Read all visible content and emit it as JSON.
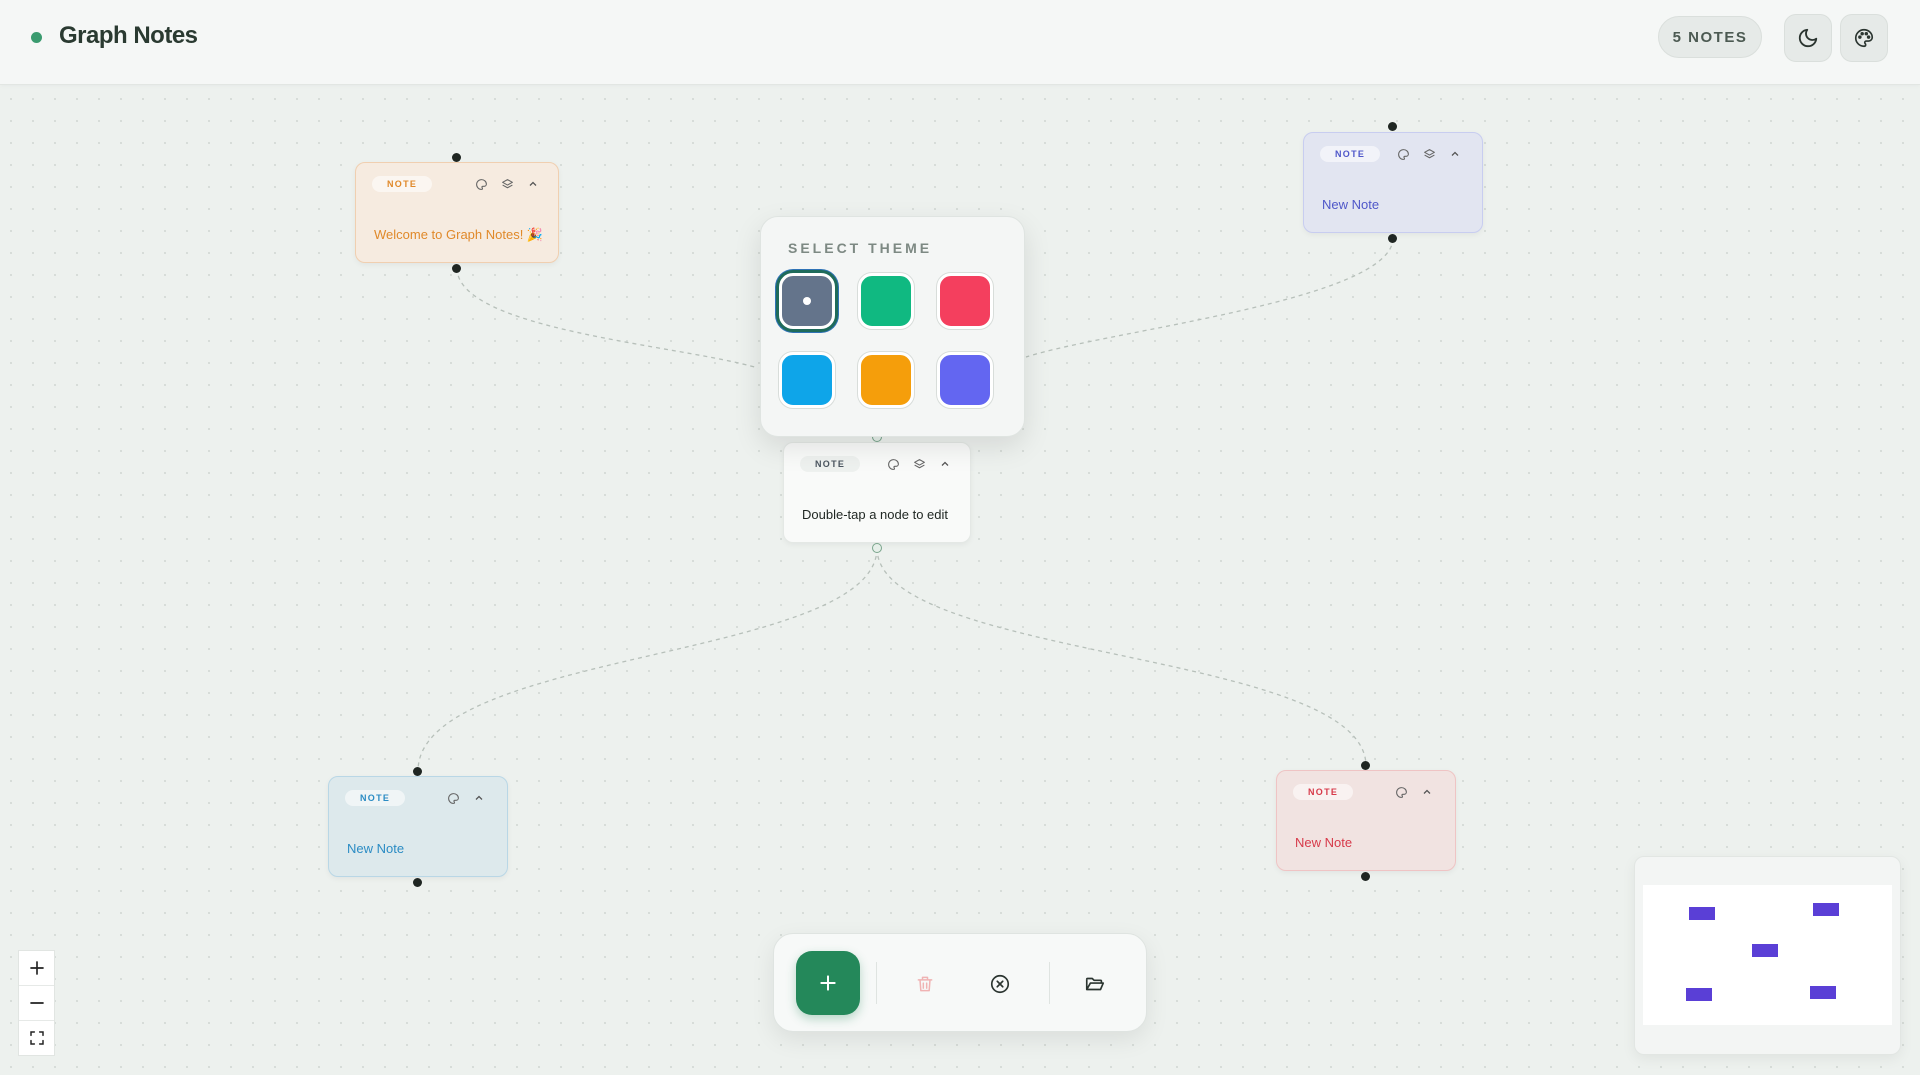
{
  "header": {
    "title": "Graph Notes",
    "notes_count": "5 NOTES",
    "dark_mode_icon": "moon-icon",
    "theme_icon": "palette-icon",
    "status_color": "#3a9b6f"
  },
  "notes": [
    {
      "id": "welcome",
      "badge": "NOTE",
      "text": "Welcome to Graph Notes! 🎉",
      "theme": "orange",
      "accent": "#e0892a",
      "bg": "#f6ebe0",
      "border": "#f0cfb0",
      "icons": [
        "palette-icon",
        "layers-icon",
        "chevron-up-icon"
      ]
    },
    {
      "id": "top-right",
      "badge": "NOTE",
      "text": "New Note",
      "theme": "indigo",
      "accent": "#4f57c9",
      "bg": "#e2e5f1",
      "border": "#c8cdf0",
      "icons": [
        "palette-icon",
        "layers-icon",
        "chevron-up-icon"
      ]
    },
    {
      "id": "center",
      "badge": "NOTE",
      "text": "Double-tap a node to edit",
      "theme": "slate",
      "accent": "#4b5560",
      "bg": "#f9faf9",
      "border": "#e4e8e5",
      "icons": [
        "palette-icon",
        "layers-icon",
        "chevron-up-icon"
      ]
    },
    {
      "id": "bottom-left",
      "badge": "NOTE",
      "text": "New Note",
      "theme": "sky",
      "accent": "#2b8cc4",
      "bg": "#dde9ec",
      "border": "#b9d7e6",
      "icons": [
        "palette-icon",
        "chevron-up-icon"
      ]
    },
    {
      "id": "bottom-right",
      "badge": "NOTE",
      "text": "New Note",
      "theme": "rose",
      "accent": "#d73a4a",
      "bg": "#f1e3e1",
      "border": "#efc4c4",
      "icons": [
        "palette-icon",
        "chevron-up-icon"
      ]
    }
  ],
  "theme_picker": {
    "title": "SELECT THEME",
    "selected": "slate",
    "swatches": [
      {
        "name": "slate",
        "color": "#64748b"
      },
      {
        "name": "emerald",
        "color": "#10b981"
      },
      {
        "name": "rose",
        "color": "#f43f5e"
      },
      {
        "name": "sky",
        "color": "#0ea5e9"
      },
      {
        "name": "amber",
        "color": "#f59e0b"
      },
      {
        "name": "indigo",
        "color": "#6366f1"
      }
    ]
  },
  "zoom_controls": [
    "plus-icon",
    "minus-icon",
    "fit-view-icon"
  ],
  "toolbar": {
    "add_icon": "plus-icon",
    "delete_icon": "trash-icon",
    "clear_icon": "x-circle-icon",
    "open_icon": "folder-open-icon",
    "primary_color": "#24885a"
  },
  "minimap": {
    "node_color": "#5a3fd6",
    "node_count": 5
  }
}
